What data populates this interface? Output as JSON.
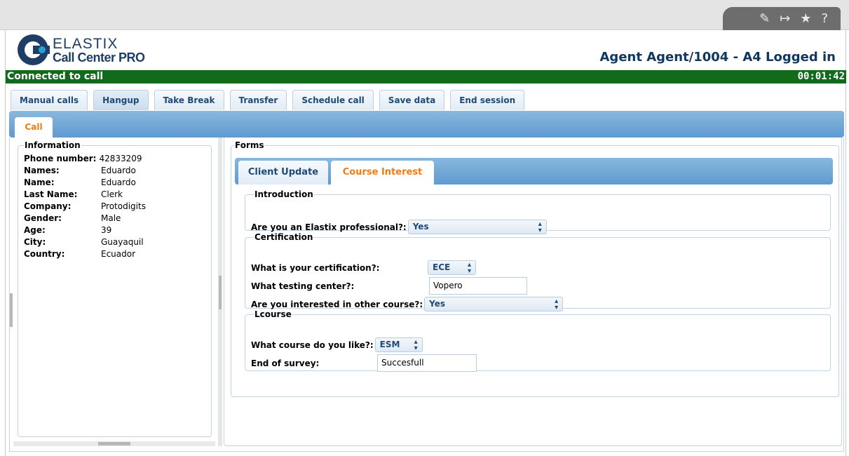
{
  "header": {
    "logo_top": "ELASTIX",
    "logo_bottom": "Call Center PRO",
    "agent_status": "Agent Agent/1004 - A4 Logged in"
  },
  "status": {
    "text": "Connected to call",
    "timer": "00:01:42"
  },
  "toolbar": {
    "buttons": [
      "Manual calls",
      "Hangup",
      "Take Break",
      "Transfer",
      "Schedule call",
      "Save data",
      "End session"
    ]
  },
  "tabs": {
    "call": "Call"
  },
  "information": {
    "legend": "Information",
    "phone_label": "Phone number:",
    "phone_value": "42833209",
    "rows": [
      {
        "key": "Names:",
        "value": "Eduardo"
      },
      {
        "key": "Name:",
        "value": "Eduardo"
      },
      {
        "key": "Last Name:",
        "value": "Clerk"
      },
      {
        "key": "Company:",
        "value": "Protodigits"
      },
      {
        "key": "Gender:",
        "value": "Male"
      },
      {
        "key": "Age:",
        "value": "39"
      },
      {
        "key": "City:",
        "value": "Guayaquil"
      },
      {
        "key": "Country:",
        "value": "Ecuador"
      }
    ]
  },
  "forms": {
    "legend": "Forms",
    "tabs": [
      "Client Update",
      "Course Interest"
    ],
    "intro": {
      "legend": "Introduction",
      "q1_label": "Are you an Elastix professional?:",
      "q1_value": "Yes"
    },
    "cert": {
      "legend": "Certification",
      "q1_label": "What is your certification?:",
      "q1_value": "ECE",
      "q2_label": "What testing center?:",
      "q2_value": "Vopero",
      "q3_label": "Are you interested in other course?:",
      "q3_value": "Yes"
    },
    "lcourse": {
      "legend": "Lcourse",
      "q1_label": "What course do you like?:",
      "q1_value": "ESM",
      "q2_label": "End of survey:",
      "q2_value": "Succesfull"
    }
  },
  "icons": [
    "edit-icon",
    "exit-icon",
    "star-icon",
    "help-icon"
  ],
  "colors": {
    "status_green": "#126b1c",
    "tab_blue": "#5f9ad1",
    "active_tab_orange": "#f07a12",
    "brand_navy": "#1f3e66"
  }
}
